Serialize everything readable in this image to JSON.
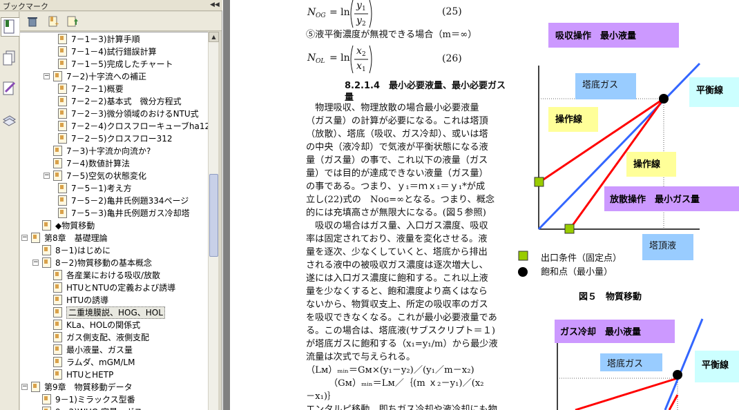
{
  "panel": {
    "title": "ブックマーク",
    "collapse_glyph": "◀◀"
  },
  "tree": [
    {
      "label": "7－1－3)計算手順",
      "level": 3,
      "expander": ""
    },
    {
      "label": "7－1－4)試行錯誤計算",
      "level": 3,
      "expander": ""
    },
    {
      "label": "7－1－5)完成したチャート",
      "level": 3,
      "expander": ""
    },
    {
      "label": "7－2)十字流への補正",
      "level": 2,
      "expander": "−"
    },
    {
      "label": "7－2－1)概要",
      "level": 3,
      "expander": ""
    },
    {
      "label": "7－2－2)基本式　微分方程式",
      "level": 3,
      "expander": ""
    },
    {
      "label": "7－2－3)微分領域のおけるNTU式",
      "level": 3,
      "expander": ""
    },
    {
      "label": "7－2－4)クロスフローキューブha12,tw1",
      "level": 3,
      "expander": ""
    },
    {
      "label": "7－2－5)クロスフロー312",
      "level": 3,
      "expander": ""
    },
    {
      "label": "7－3)十字流か向流か?",
      "level": 2,
      "expander": ""
    },
    {
      "label": "7－4)数値計算法",
      "level": 2,
      "expander": ""
    },
    {
      "label": "7－5)空気の状態変化",
      "level": 2,
      "expander": "−"
    },
    {
      "label": "7－5－1)考え方",
      "level": 3,
      "expander": ""
    },
    {
      "label": "7－5－2)亀井氏例題334ページ",
      "level": 3,
      "expander": ""
    },
    {
      "label": "7－5－3)亀井氏例題ガス冷却塔",
      "level": 3,
      "expander": ""
    },
    {
      "label": "◆物質移動",
      "level": 1,
      "expander": ""
    },
    {
      "label": "第8章　基礎理論",
      "level": 0,
      "expander": "−"
    },
    {
      "label": "8－1)はじめに",
      "level": 1,
      "expander": ""
    },
    {
      "label": "8－2)物質移動の基本概念",
      "level": 1,
      "expander": "−"
    },
    {
      "label": "各産業における吸収/放散",
      "level": 2,
      "expander": ""
    },
    {
      "label": "HTUとNTUの定義および誘導",
      "level": 2,
      "expander": ""
    },
    {
      "label": "HTUの誘導",
      "level": 2,
      "expander": ""
    },
    {
      "label": "二重境膜説、HOG、HOL",
      "level": 2,
      "expander": "",
      "selected": true
    },
    {
      "label": "KLa、HOLの関係式",
      "level": 2,
      "expander": ""
    },
    {
      "label": "ガス側支配、液側支配",
      "level": 2,
      "expander": ""
    },
    {
      "label": "最小液量、ガス量",
      "level": 2,
      "expander": ""
    },
    {
      "label": "ラムダ、mGM/LM",
      "level": 2,
      "expander": ""
    },
    {
      "label": "HTUとHETP",
      "level": 2,
      "expander": ""
    },
    {
      "label": "第9章　物質移動データ",
      "level": 0,
      "expander": "−"
    },
    {
      "label": "9－1)ミラックス型番",
      "level": 1,
      "expander": ""
    },
    {
      "label": "9－2)WHO 容量・ガス",
      "level": 1,
      "expander": ""
    }
  ],
  "doc": {
    "eq25_lhs": "N",
    "eq25_sub": "OG",
    "eq25_mid": "= ln",
    "eq25_num": "y",
    "eq25_num_sub": "1",
    "eq25_den": "y",
    "eq25_den_sub": "2",
    "eq25_no": "(25)",
    "case_line": "⑤液平衡濃度が無視できる場合（m＝∞）",
    "eq26_lhs": "N",
    "eq26_sub": "OL",
    "eq26_mid": "= ln",
    "eq26_num": "x",
    "eq26_num_sub": "2",
    "eq26_den": "x",
    "eq26_den_sub": "1",
    "eq26_no": "(26)",
    "heading_1": "8.2.1.4　最小必要液量、最小必要ガス",
    "heading_2": "量",
    "paragraph_lines": [
      "　物理吸収、物理放散の場合最小必要液量",
      "（ガス量）の計算が必要になる。これは塔頂",
      "（放散）、塔底（吸収、ガス冷却）、或いは塔",
      "の中央（液冷却）で気液が平衡状態になる液",
      "量（ガス量）の事で、これ以下の液量（ガス",
      "量）では目的が達成できない液量（ガス量）",
      "の事である。つまり、ｙ₁＝ｍｘ₁＝ｙ₁*が成",
      "立し(22)式の　Nᴏɢ=∞となる。つまり、概念",
      "的には充填高さが無限大になる。(図５参照)",
      "　吸収の場合はガス量、入口ガス濃度、吸収",
      "率は固定されており、液量を変化させる。液",
      "量を逐次、少なくしていくと、塔底から排出",
      "される液中の被吸収ガス濃度は逐次増大し、",
      "遂には入口ガス濃度に飽和する。これ以上液",
      "量を少なくすると、飽和濃度より高くはなら",
      "ないから、物質収支上、所定の吸収率のガス",
      "を吸収できなくなる。これが最小必要液量であ",
      "る。この場合は、塔底液(サブスクリプト＝１)",
      "が塔底ガスに飽和する（x₁=y₁/m）から最少液",
      "流量は次式で与えられる。",
      "（Lᴍ）ₘᵢₙ＝Gᴍ×(y₁－y₂)／(y₁／m－x₂)",
      "　　　（Gᴍ）ₘᵢₙ＝Lᴍ／｛(m ｘ₂－y₁)／(x₂",
      "－x₁)｝",
      "エンタルピ移動、即ちガス冷却や液冷却にも物"
    ]
  },
  "figure5": {
    "title_box": "吸収操作　最小液量",
    "tower_bottom_gas": "塔底ガス",
    "equilibrium_line": "平衡線",
    "operating_line_1": "操作線",
    "operating_line_2": "操作線",
    "desorption_box": "放散操作　最小ガス量",
    "tower_top_liquid": "塔頂液",
    "legend_square": "出口条件（固定点）",
    "legend_circle": "飽和点（最小量）",
    "caption": "図５　物質移動"
  },
  "figure6": {
    "title_box": "ガス冷却　最小液量",
    "tower_bottom_gas": "塔底ガス",
    "equilibrium_line": "平衡線"
  },
  "colors": {
    "purple": "#cc99ff",
    "blue": "#99ccff",
    "cyan": "#ccffff",
    "yellow": "#ffff99",
    "equilibrium": "#3366ff",
    "operating": "#ff0000",
    "fixed_point": "#99cc00"
  }
}
